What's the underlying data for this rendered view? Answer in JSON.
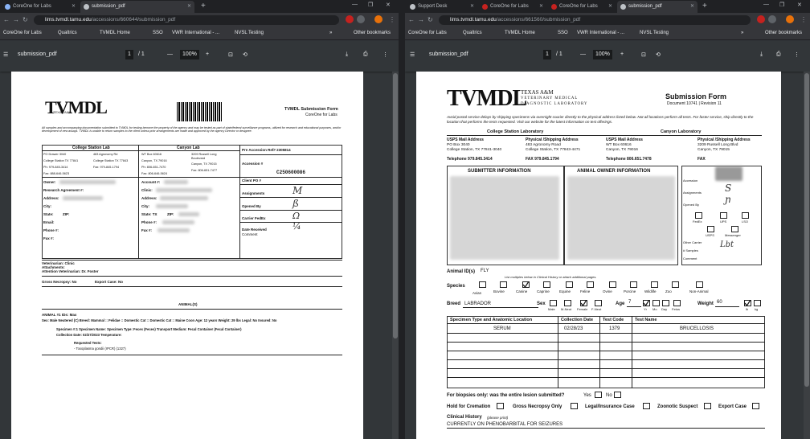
{
  "left": {
    "tabs": [
      {
        "label": "CoreOne for Labs"
      },
      {
        "label": "submission_pdf"
      }
    ],
    "url_host": "lims.tvmdl.tamu.edu",
    "url_path": "/accessions/660644/submission_pdf",
    "bookmarks": [
      "CoreOne for Labs",
      "Qualtrics",
      "TVMDL Home",
      "SSO",
      "VWR International - ...",
      "NVSL Testing"
    ],
    "other_bookmarks": "Other bookmarks",
    "pdf": {
      "title": "submission_pdf",
      "page": "1",
      "total": "/ 1",
      "zoom": "100%"
    },
    "doc": {
      "logo": "TVMDL",
      "logo_small": "TEXAS A&M",
      "form_title": "TVMDL Submission Form",
      "form_sub": "CoreOne for Labs",
      "disclaimer": "All samples and accompanying documentation submitted to TVMDL for testing become the property of the agency and may be tested as part of state/federal surveillance programs, utilized for research and educational purposes, and/or development of new assays. TVMDL is unable to return samples to the client unless prior arrangements are made and approved by the agency Director or designee.",
      "cs_lab": "College Station Lab",
      "cs_addr": [
        "PO Drawer 3040",
        "College Station TX 77841",
        "Ph: 979-845-3414",
        "Fax: 888-646-5623"
      ],
      "cs_addr2": [
        "483 Agronomy Rd",
        "College Station TX 77843",
        "Fax: 979-845-1794"
      ],
      "cy_lab": "Canyon Lab",
      "cy_addr": [
        "WT Box 60616",
        "Canyon, TX 79016",
        "Ph: 806-651-7470",
        "Fax: 806-646-5624"
      ],
      "cy_addr2": [
        "3209 Russell Long",
        "Boulevard",
        "Canyon, TX 79015",
        "Fax: 806-651-7477"
      ],
      "pre_accession": "Pre Accession Ref# 2305814",
      "accession": "Accession #",
      "accession_no": "C250600086",
      "client_po": "Client PO #",
      "assignments": "Assignments",
      "opened_by": "Opened By",
      "carrier": "Carrier FedEx",
      "date_received": "Date Received",
      "comment": "Comment",
      "owner": "Owner:",
      "research": "Research Agreement #:",
      "address": "Address:",
      "city": "City:",
      "state": "State:",
      "zip": "ZIP:",
      "email": "Email:",
      "phone": "Phone #:",
      "fax": "Fax #:",
      "account": "Account #:",
      "clinic": "Clinic:",
      "address2": "Address:",
      "city2": "City:",
      "state2": "State: TX",
      "zip2": "ZIP:",
      "phone2": "Phone #:",
      "fax2": "Fax #:",
      "attachments": "Attachments:",
      "vet": "Veterinarian: Clinic",
      "att_vet": "Attention Veterinarian: Dr. Foster",
      "necropsy": "Gross Necropsy: No",
      "export": "Export Case: No",
      "animals": "ANIMAL(S)",
      "animal1": "ANIMAL #1     IDs: Max",
      "animal_line": "Sex: Male Neutered (C) Breed: Mammal :: Felidae :: Domestic Cat :: Domestic Cat :: Maine Coon Age: 12 years Weight: 29 lbs Legal: No Insured: No",
      "specimen": "Specimen #:1   Specimen Name:     Specimen Type: Feces (Feces)   Transport Medium: Fecal Container (Fecal Container)",
      "collection": "Collection Date: 02/27/2023     Temperature:",
      "requested": "Requested Tests:",
      "test1": "- Toxoplasma gondii (rPCR) (1327)",
      "hw": {
        "assign": "M",
        "opened": "ß",
        "carrier": "Ω",
        "date": "¼"
      }
    }
  },
  "right": {
    "tabs": [
      {
        "label": "Support Desk"
      },
      {
        "label": "CoreOne for Labs"
      },
      {
        "label": "CoreOne for Labs"
      },
      {
        "label": "submission_pdf"
      }
    ],
    "url_host": "lims.tvmdl.tamu.edu",
    "url_path": "/accessions/661560/submission_pdf",
    "bookmarks": [
      "CoreOne for Labs",
      "Qualtrics",
      "TVMDL Home",
      "SSO",
      "VWR International - ...",
      "NVSL Testing"
    ],
    "other_bookmarks": "Other bookmarks",
    "pdf": {
      "title": "submission_pdf",
      "page": "1",
      "total": "/ 1",
      "zoom": "100%"
    },
    "doc": {
      "logo": "TVMDL",
      "org": [
        "TEXAS A&M",
        "VETERINARY MEDICAL",
        "DIAGNOSTIC LABORATORY"
      ],
      "form_title": "Submission Form",
      "form_doc": "Document 10741 | Revision 11",
      "notice": "Avoid postal service delays by shipping specimens via overnight courier directly to the physical address listed below. Not all locations perform all tests. For faster service, ship directly to the location that performs the tests requested. Visit our website for the latest information on test offerings.",
      "cs_lab": "College Station Laboratory",
      "cy_lab": "Canyon Laboratory",
      "usps": "USPS Mail Address",
      "phys": "Physical /Shipping Address",
      "cs_usps": [
        "PO Box 3040",
        "College Station, TX 77841-3040"
      ],
      "cs_phys": [
        "483 Agronomy Road",
        "College Station, TX 77843-4471"
      ],
      "cs_tel": "Telephone 979.845.3414",
      "cs_fax": "FAX 979.845.1794",
      "cy_usps": [
        "WT Box 60616",
        "Canyon, TX 79016"
      ],
      "cy_phys": [
        "3209 Russell Long Blvd",
        "Canyon, TX 79015"
      ],
      "cy_tel": "Telephone 806.651.7478",
      "cy_fax": "FAX",
      "submitter": "SUBMITTER INFORMATION",
      "owner": "ANIMAL OWNER INFORMATION",
      "accession": "Accession",
      "assignments": "Assignments",
      "opened_by": "Opened By",
      "fedex": "FedEx",
      "ups": "UPS",
      "lso": "LSO",
      "usps2": "USPS",
      "messenger": "Messenger",
      "other_carrier": "Other Carrier",
      "samples": "# Samples",
      "comment": "Comment",
      "animal_ids": "Animal ID(s)",
      "animal_id_val": "FLY",
      "animal_note": "List multiples below in Clinical History or attach additional pages.",
      "species": "Species",
      "species_list": [
        "Avian",
        "Bovine",
        "Canine",
        "Caprine",
        "Equine",
        "Feline",
        "Ovine",
        "Porcine",
        "Wildlife",
        "Zoo",
        "Non-Animal"
      ],
      "breed": "Breed",
      "breed_val": "LABRADOR",
      "sex": "Sex",
      "sex_opts": [
        "Male",
        "M-Neut",
        "Female",
        "F-Neut"
      ],
      "age": "Age",
      "age_val": "7",
      "age_units": [
        "Yr",
        "Mo",
        "Day"
      ],
      "age_units2": [
        "Fetus"
      ],
      "weight": "Weight",
      "weight_val": "60",
      "weight_units": [
        "lb",
        "kg"
      ],
      "table_headers": [
        "Specimen Type and Anatomic Location",
        "Collection Date",
        "Test Code",
        "Test Name"
      ],
      "table_row": [
        "SERUM",
        "02/28/23",
        "1379",
        "BRUCELLOSIS"
      ],
      "biopsy": "For biopsies only: was the entire lesion submitted?",
      "yes": "Yes",
      "no": "No",
      "hold": "Hold for Cremation",
      "gross": "Gross Necropsy Only",
      "legal": "Legal/Insurance Case",
      "zoonotic": "Zoonotic Suspect",
      "exportc": "Export Case",
      "clinical": "Clinical History",
      "clinical_note": "(please print)",
      "clinical_val": "CURRENTLY ON PHENOBARBITAL FOR SEIZURES",
      "hw": {
        "assign": "S",
        "opened": "ɲ",
        "samples": "Lbt"
      }
    }
  }
}
